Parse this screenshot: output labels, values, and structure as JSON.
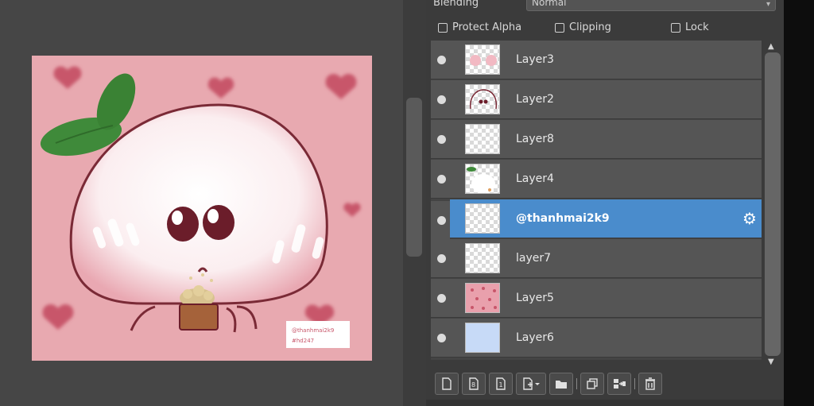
{
  "panel": {
    "blending_label": "Blending",
    "blending_value": "Normal",
    "options": {
      "protect_alpha": "Protect Alpha",
      "clipping": "Clipping",
      "lock": "Lock"
    }
  },
  "layers": [
    {
      "name": "Layer3",
      "thumb": "pink-dots"
    },
    {
      "name": "Layer2",
      "thumb": "face"
    },
    {
      "name": "Layer8",
      "thumb": "transparent"
    },
    {
      "name": "Layer4",
      "thumb": "white-blob"
    },
    {
      "name": "@thanhmai2k9",
      "thumb": "transparent",
      "selected": true
    },
    {
      "name": "layer7",
      "thumb": "transparent"
    },
    {
      "name": "Layer5",
      "thumb": "pink-pattern"
    },
    {
      "name": "Layer6",
      "thumb": "light-blue"
    }
  ],
  "canvas": {
    "signature_line1": "@thanhmai2k9",
    "signature_line2": "#hd247"
  },
  "colors": {
    "selected_row": "#4a8ccc",
    "canvas_pink": "#e8a9b0",
    "leaf_green": "#3f8a3a",
    "heart": "#c8566a"
  },
  "toolbar_icons": [
    "new-layer-icon",
    "new-8bit-layer-icon",
    "new-1bit-layer-icon",
    "add-layer-menu-icon",
    "folder-icon",
    "duplicate-layer-icon",
    "merge-layer-icon",
    "delete-layer-icon"
  ]
}
